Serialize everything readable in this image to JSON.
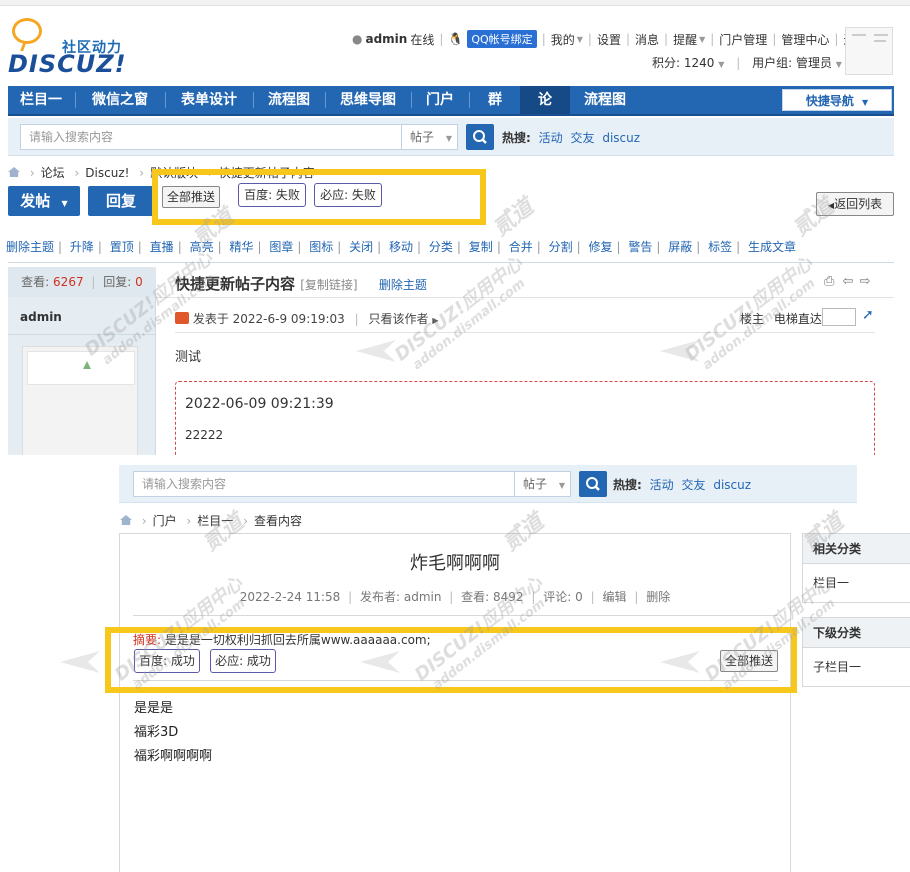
{
  "header": {
    "logo_cn": "社区动力",
    "logo_en": "DISCUZ!",
    "username": "admin",
    "online": "在线",
    "qq_bind": "QQ帐号绑定",
    "menu_mine": "我的",
    "menu_settings": "设置",
    "menu_messages": "消息",
    "menu_remind": "提醒",
    "menu_portal_manage": "门户管理",
    "menu_admin_center": "管理中心",
    "menu_logout": "退出",
    "points": "积分: 1240",
    "usergroup": "用户组: 管理员"
  },
  "nav": {
    "items": [
      "栏目一",
      "微信之窗",
      "表单设计",
      "流程图",
      "思维导图",
      "门户",
      "群组",
      "论坛",
      "流程图"
    ],
    "quick_nav": "快捷导航"
  },
  "search": {
    "placeholder": "请输入搜索内容",
    "type": "帖子",
    "hot_label": "热搜:",
    "hot_links": [
      "活动",
      "交友",
      "discuz"
    ]
  },
  "thread": {
    "breadcrumb": [
      "论坛",
      "Discuz!",
      "默认版块",
      "快捷更新帖子内容"
    ],
    "post_button": "发帖",
    "reply_button": "回复",
    "push_all": "全部推送",
    "baidu_status": "百度: 失败",
    "bing_status": "必应: 失败",
    "back_to_list": "返回列表",
    "mod_actions": [
      "删除主题",
      "升降",
      "置顶",
      "直播",
      "高亮",
      "精华",
      "图章",
      "图标",
      "关闭",
      "移动",
      "分类",
      "复制",
      "合并",
      "分割",
      "修复",
      "警告",
      "屏蔽",
      "标签",
      "生成文章"
    ],
    "views_label": "查看:",
    "views": "6267",
    "replies_label": "回复:",
    "replies": "0",
    "author": "admin",
    "title": "快捷更新帖子内容",
    "copy_link": "[复制链接]",
    "delete_thread": "删除主题",
    "posted_at": "发表于 2022-6-9 09:19:03",
    "only_author": "只看该作者",
    "floor": "楼主",
    "elevator": "电梯直达",
    "body": "测试",
    "quote_time": "2022-06-09 09:21:39",
    "quote_text": "22222"
  },
  "article": {
    "breadcrumb": [
      "门户",
      "栏目一",
      "查看内容"
    ],
    "title": "炸毛啊啊啊",
    "date": "2022-2-24 11:58",
    "publisher": "发布者: admin",
    "views": "查看: 8492",
    "comments": "评论: 0",
    "edit": "编辑",
    "delete": "删除",
    "summary_label": "摘要:",
    "summary_text": "是是是一切权利归抓回去所属www.aaaaaa.com;",
    "baidu_status": "百度: 成功",
    "bing_status": "必应: 成功",
    "push_all": "全部推送",
    "content": [
      "是是是",
      "福彩3D",
      "福彩啊啊啊啊"
    ],
    "side_related": "相关分类",
    "side_related_item": "栏目一",
    "side_sub": "下级分类",
    "side_sub_item": "子栏目一"
  },
  "watermark": {
    "brand": "DISCUZ!应用中心",
    "domain": "addon.dismall.com",
    "mark": "贰道"
  },
  "colors": {
    "brand_blue": "#2366b2",
    "highlight_yellow": "#f8c71c",
    "status_red": "#d0301e"
  }
}
